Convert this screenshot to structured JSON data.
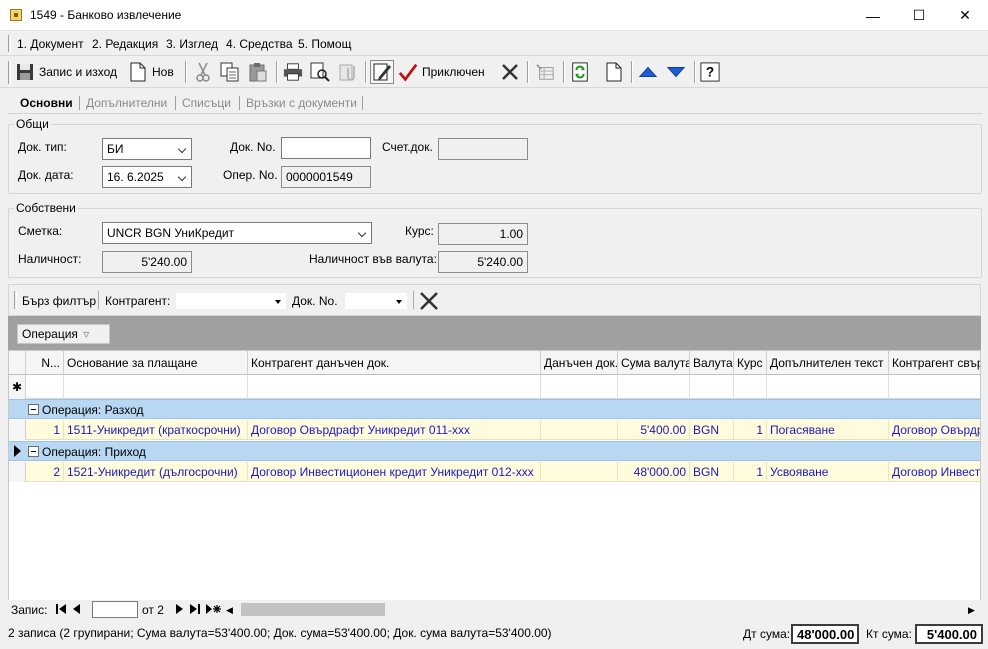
{
  "window": {
    "title": "1549 - Банково извлечение",
    "minimize": "—",
    "maximize": "☐",
    "close": "✕"
  },
  "menu": [
    {
      "label": "1. Документ"
    },
    {
      "label": "2. Редакция"
    },
    {
      "label": "3. Изглед"
    },
    {
      "label": "4. Средства"
    },
    {
      "label": "5. Помощ"
    }
  ],
  "toolbar": {
    "save_exit": "Запис и изход",
    "new": "Нов",
    "finished": "Приключен"
  },
  "tabs": [
    {
      "label": "Основни",
      "active": true
    },
    {
      "label": "Допълнителни",
      "active": false
    },
    {
      "label": "Списъци",
      "active": false
    },
    {
      "label": "Връзки с документи",
      "active": false
    }
  ],
  "general": {
    "title": "Общи",
    "doc_type_label": "Док. тип:",
    "doc_type_value": "БИ",
    "doc_no_label": "Док. No.",
    "doc_no_value": "",
    "acc_doc_label": "Счет.док.",
    "acc_doc_value": "",
    "doc_date_label": "Док. дата:",
    "doc_date_value": "16.  6.2025",
    "oper_no_label": "Опер. No.",
    "oper_no_value": "0000001549"
  },
  "own": {
    "title": "Собствени",
    "account_label": "Сметка:",
    "account_value": "UNCR BGN УниКредит",
    "rate_label": "Курс:",
    "rate_value": "1.00",
    "balance_label": "Наличност:",
    "balance_value": "5'240.00",
    "balance_cur_label": "Наличност във валута:",
    "balance_cur_value": "5'240.00"
  },
  "filter": {
    "quick_filter": "Бърз филтър",
    "contractor_label": "Контрагент:",
    "contractor_value": "",
    "doc_no_label": "Док. No.",
    "doc_no_value": ""
  },
  "group_panel": {
    "chip": "Операция",
    "chip_icon": "▿"
  },
  "grid": {
    "columns": [
      "N...",
      "Основание за плащане",
      "Контрагент данъчен док.",
      "Данъчен док.",
      "Сума валута",
      "Валута",
      "Курс",
      "Допълнителен текст",
      "Контрагент свързан"
    ],
    "new_row_marker": "✱",
    "groups": [
      {
        "label": "Операция: Разход",
        "rows": [
          {
            "n": "1",
            "basis": "1511-Уникредит (краткосрочни)",
            "contractor": "Договор Овърдрафт Уникредит 011-xxx",
            "tax_doc": "",
            "amount": "5'400.00",
            "currency": "BGN",
            "rate": "1",
            "text": "Погасяване",
            "linked": "Договор Овърдрафт"
          }
        ]
      },
      {
        "label": "Операция: Приход",
        "rows": [
          {
            "n": "2",
            "basis": "1521-Уникредит (дългосрочни)",
            "contractor": "Договор Инвестиционен кредит Уникредит 012-xxx",
            "tax_doc": "",
            "amount": "48'000.00",
            "currency": "BGN",
            "rate": "1",
            "text": "Усвояване",
            "linked": "Договор Инвестиционен"
          }
        ]
      }
    ]
  },
  "navigator": {
    "label": "Запис:",
    "value": "",
    "of": "от 2"
  },
  "status": {
    "summary": "2 записа (2 групирани; Сума валута=53'400.00; Док. сума=53'400.00; Док. сума валута=53'400.00)",
    "debit_label": "Дт сума:",
    "debit_value": "48'000.00",
    "credit_label": "Кт сума:",
    "credit_value": "5'400.00"
  },
  "colors": {
    "group_row": "#b8d7f2",
    "data_row": "#fffbdc",
    "link_text": "#1a1ab4",
    "group_panel": "#a0a0a0"
  }
}
